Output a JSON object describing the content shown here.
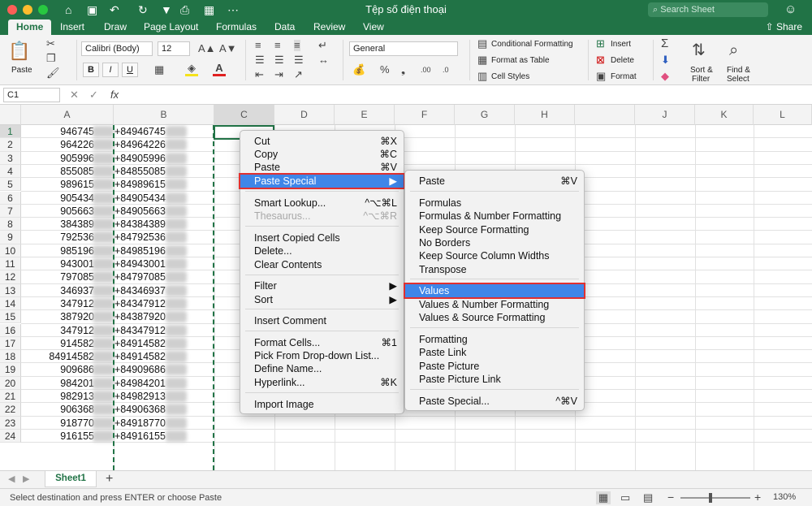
{
  "window": {
    "title": "Tệp số điện thoại",
    "search_placeholder": "Search Sheet"
  },
  "tabs": [
    "Home",
    "Insert",
    "Draw",
    "Page Layout",
    "Formulas",
    "Data",
    "Review",
    "View"
  ],
  "share_label": "Share",
  "ribbon": {
    "paste_label": "Paste",
    "font_name": "Calibri (Body)",
    "font_size": "12",
    "number_format": "General",
    "conditional_formatting": "Conditional Formatting",
    "format_as_table": "Format as Table",
    "cell_styles": "Cell Styles",
    "insert": "Insert",
    "delete": "Delete",
    "format": "Format",
    "sort_filter_line1": "Sort &",
    "sort_filter_line2": "Filter",
    "find_select_line1": "Find &",
    "find_select_line2": "Select"
  },
  "formula_bar": {
    "name_box": "C1",
    "fx": "fx"
  },
  "columns": [
    "A",
    "B",
    "C",
    "D",
    "E",
    "F",
    "G",
    "H",
    "J",
    "K",
    "L"
  ],
  "rows": [
    {
      "n": "1",
      "a": "946745",
      "b": "+84946745"
    },
    {
      "n": "2",
      "a": "964226",
      "b": "+84964226"
    },
    {
      "n": "3",
      "a": "905996",
      "b": "+84905996"
    },
    {
      "n": "4",
      "a": "855085",
      "b": "+84855085"
    },
    {
      "n": "5",
      "a": "989615",
      "b": "+84989615"
    },
    {
      "n": "6",
      "a": "905434",
      "b": "+84905434"
    },
    {
      "n": "7",
      "a": "905663",
      "b": "+84905663"
    },
    {
      "n": "8",
      "a": "384389",
      "b": "+84384389"
    },
    {
      "n": "9",
      "a": "792536",
      "b": "+84792536"
    },
    {
      "n": "10",
      "a": "985196",
      "b": "+84985196"
    },
    {
      "n": "11",
      "a": "943001",
      "b": "+84943001"
    },
    {
      "n": "12",
      "a": "797085",
      "b": "+84797085"
    },
    {
      "n": "13",
      "a": "346937",
      "b": "+84346937"
    },
    {
      "n": "14",
      "a": "347912",
      "b": "+84347912"
    },
    {
      "n": "15",
      "a": "387920",
      "b": "+84387920"
    },
    {
      "n": "16",
      "a": "347912",
      "b": "+84347912"
    },
    {
      "n": "17",
      "a": "914582",
      "b": "+84914582"
    },
    {
      "n": "18",
      "a": "84914582",
      "b": "+84914582"
    },
    {
      "n": "19",
      "a": "909686",
      "b": "+84909686"
    },
    {
      "n": "20",
      "a": "984201",
      "b": "+84984201"
    },
    {
      "n": "21",
      "a": "982913",
      "b": "+84982913"
    },
    {
      "n": "22",
      "a": "906368",
      "b": "+84906368"
    },
    {
      "n": "23",
      "a": "918770",
      "b": "+84918770"
    },
    {
      "n": "24",
      "a": "916155",
      "b": "+84916155"
    }
  ],
  "context_menu": [
    {
      "label": "Cut",
      "shortcut": "⌘X"
    },
    {
      "label": "Copy",
      "shortcut": "⌘C"
    },
    {
      "label": "Paste",
      "shortcut": "⌘V"
    },
    {
      "label": "Paste Special",
      "shortcut": "▶"
    },
    {
      "label": "Smart Lookup...",
      "shortcut": "^⌥⌘L"
    },
    {
      "label": "Thesaurus...",
      "shortcut": "^⌥⌘R"
    },
    {
      "label": "Insert Copied Cells",
      "shortcut": ""
    },
    {
      "label": "Delete...",
      "shortcut": ""
    },
    {
      "label": "Clear Contents",
      "shortcut": ""
    },
    {
      "label": "Filter",
      "shortcut": "▶"
    },
    {
      "label": "Sort",
      "shortcut": "▶"
    },
    {
      "label": "Insert Comment",
      "shortcut": ""
    },
    {
      "label": "Format Cells...",
      "shortcut": "⌘1"
    },
    {
      "label": "Pick From Drop-down List...",
      "shortcut": ""
    },
    {
      "label": "Define Name...",
      "shortcut": ""
    },
    {
      "label": "Hyperlink...",
      "shortcut": "⌘K"
    },
    {
      "label": "Import Image",
      "shortcut": ""
    }
  ],
  "paste_special_menu": [
    {
      "label": "Paste",
      "shortcut": "⌘V"
    },
    {
      "label": "Formulas",
      "shortcut": ""
    },
    {
      "label": "Formulas & Number Formatting",
      "shortcut": ""
    },
    {
      "label": "Keep Source Formatting",
      "shortcut": ""
    },
    {
      "label": "No Borders",
      "shortcut": ""
    },
    {
      "label": "Keep Source Column Widths",
      "shortcut": ""
    },
    {
      "label": "Transpose",
      "shortcut": ""
    },
    {
      "label": "Values",
      "shortcut": ""
    },
    {
      "label": "Values & Number Formatting",
      "shortcut": ""
    },
    {
      "label": "Values & Source Formatting",
      "shortcut": ""
    },
    {
      "label": "Formatting",
      "shortcut": ""
    },
    {
      "label": "Paste Link",
      "shortcut": ""
    },
    {
      "label": "Paste Picture",
      "shortcut": ""
    },
    {
      "label": "Paste Picture Link",
      "shortcut": ""
    },
    {
      "label": "Paste Special...",
      "shortcut": "^⌘V"
    }
  ],
  "sheet_tab": "Sheet1",
  "status": {
    "message": "Select destination and press ENTER or choose Paste",
    "zoom": "130%"
  },
  "colors": {
    "brand": "#217346",
    "highlight": "#3f86e8",
    "callout": "#e03030"
  }
}
